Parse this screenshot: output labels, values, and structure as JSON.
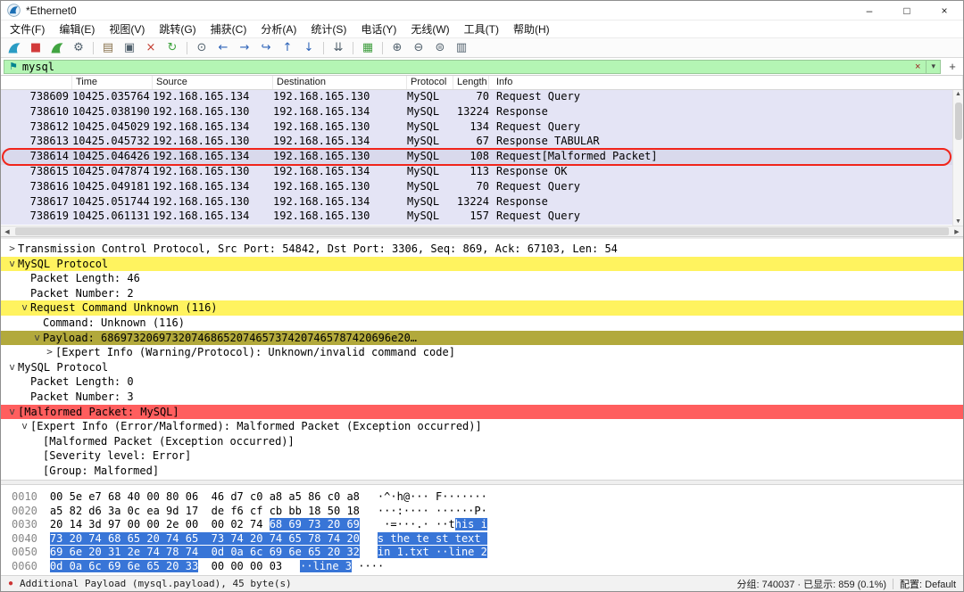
{
  "window": {
    "title": "*Ethernet0",
    "controls": [
      {
        "name": "minimize-button",
        "glyph": "–"
      },
      {
        "name": "maximize-button",
        "glyph": "□"
      },
      {
        "name": "close-button",
        "glyph": "×"
      }
    ]
  },
  "menu_bar": {
    "items": [
      "文件(F)",
      "编辑(E)",
      "视图(V)",
      "跳转(G)",
      "捕获(C)",
      "分析(A)",
      "统计(S)",
      "电话(Y)",
      "无线(W)",
      "工具(T)",
      "帮助(H)"
    ]
  },
  "toolbar": {
    "items": [
      {
        "name": "start-capture-icon",
        "kind": "fin",
        "color": "#2a9cc4"
      },
      {
        "name": "stop-capture-icon",
        "kind": "glyph",
        "glyph": "■",
        "color": "#d23b3b"
      },
      {
        "name": "restart-capture-icon",
        "kind": "fin",
        "color": "#41a441"
      },
      {
        "name": "capture-options-icon",
        "kind": "glyph",
        "glyph": "⚙",
        "color": "#50606c"
      },
      {
        "name": "toolbar-separator",
        "kind": "sep"
      },
      {
        "name": "open-file-icon",
        "kind": "glyph",
        "glyph": "▤",
        "color": "#8a7450"
      },
      {
        "name": "save-file-icon",
        "kind": "glyph",
        "glyph": "▣",
        "color": "#50606c"
      },
      {
        "name": "close-file-icon",
        "kind": "glyph",
        "glyph": "×",
        "color": "#c23b2e"
      },
      {
        "name": "reload-icon",
        "kind": "glyph",
        "glyph": "↻",
        "color": "#41a441"
      },
      {
        "name": "toolbar-separator",
        "kind": "sep"
      },
      {
        "name": "find-packet-icon",
        "kind": "glyph",
        "glyph": "⊙",
        "color": "#50606c"
      },
      {
        "name": "back-icon",
        "kind": "glyph",
        "glyph": "←",
        "color": "#2d63b8"
      },
      {
        "name": "forward-icon",
        "kind": "glyph",
        "glyph": "→",
        "color": "#2d63b8"
      },
      {
        "name": "goto-packet-icon",
        "kind": "glyph",
        "glyph": "↪",
        "color": "#2d63b8"
      },
      {
        "name": "first-packet-icon",
        "kind": "glyph",
        "glyph": "↑",
        "color": "#2d63b8"
      },
      {
        "name": "last-packet-icon",
        "kind": "glyph",
        "glyph": "↓",
        "color": "#2d63b8"
      },
      {
        "name": "toolbar-separator",
        "kind": "sep"
      },
      {
        "name": "autoscroll-icon",
        "kind": "glyph",
        "glyph": "⇊",
        "color": "#50606c"
      },
      {
        "name": "toolbar-separator",
        "kind": "sep"
      },
      {
        "name": "colorize-icon",
        "kind": "glyph",
        "glyph": "▦",
        "color": "#3f9e3f"
      },
      {
        "name": "toolbar-separator",
        "kind": "sep"
      },
      {
        "name": "zoom-in-icon",
        "kind": "glyph",
        "glyph": "⊕",
        "color": "#50606c"
      },
      {
        "name": "zoom-out-icon",
        "kind": "glyph",
        "glyph": "⊖",
        "color": "#50606c"
      },
      {
        "name": "zoom-100-icon",
        "kind": "glyph",
        "glyph": "⊜",
        "color": "#50606c"
      },
      {
        "name": "resize-columns-icon",
        "kind": "glyph",
        "glyph": "▥",
        "color": "#50606c"
      }
    ]
  },
  "filter": {
    "value": "mysql",
    "bookmark_glyph": "⚑",
    "clear_glyph": "×",
    "dropdown_glyph": "▾",
    "add_glyph": "+"
  },
  "packet_list": {
    "columns": [
      "",
      "Time",
      "Source",
      "Destination",
      "Protocol",
      "Length",
      "Info"
    ],
    "rows": [
      {
        "no": "738609",
        "time": "10425.035764",
        "source": "192.168.165.134",
        "destination": "192.168.165.130",
        "protocol": "MySQL",
        "length": "70",
        "info": "Request Query",
        "selected": false
      },
      {
        "no": "738610",
        "time": "10425.038190",
        "source": "192.168.165.130",
        "destination": "192.168.165.134",
        "protocol": "MySQL",
        "length": "13224",
        "info": "Response",
        "selected": false
      },
      {
        "no": "738612",
        "time": "10425.045029",
        "source": "192.168.165.134",
        "destination": "192.168.165.130",
        "protocol": "MySQL",
        "length": "134",
        "info": "Request Query",
        "selected": false
      },
      {
        "no": "738613",
        "time": "10425.045732",
        "source": "192.168.165.130",
        "destination": "192.168.165.134",
        "protocol": "MySQL",
        "length": "67",
        "info": "Response TABULAR",
        "selected": false
      },
      {
        "no": "738614",
        "time": "10425.046426",
        "source": "192.168.165.134",
        "destination": "192.168.165.130",
        "protocol": "MySQL",
        "length": "108",
        "info": "Request[Malformed Packet]",
        "selected": true
      },
      {
        "no": "738615",
        "time": "10425.047874",
        "source": "192.168.165.130",
        "destination": "192.168.165.134",
        "protocol": "MySQL",
        "length": "113",
        "info": "Response OK",
        "selected": false
      },
      {
        "no": "738616",
        "time": "10425.049181",
        "source": "192.168.165.134",
        "destination": "192.168.165.130",
        "protocol": "MySQL",
        "length": "70",
        "info": "Request Query",
        "selected": false
      },
      {
        "no": "738617",
        "time": "10425.051744",
        "source": "192.168.165.130",
        "destination": "192.168.165.134",
        "protocol": "MySQL",
        "length": "13224",
        "info": "Response",
        "selected": false
      },
      {
        "no": "738619",
        "time": "10425.061131",
        "source": "192.168.165.134",
        "destination": "192.168.165.130",
        "protocol": "MySQL",
        "length": "157",
        "info": "Request Query",
        "selected": false
      }
    ]
  },
  "detail_tree": {
    "lines": [
      {
        "indent": 0,
        "arrow": "right",
        "text": "Transmission Control Protocol, Src Port: 54842, Dst Port: 3306, Seq: 869, Ack: 67103, Len: 54",
        "bg": "none"
      },
      {
        "indent": 0,
        "arrow": "down",
        "text": "MySQL Protocol",
        "bg": "yellow"
      },
      {
        "indent": 1,
        "arrow": "none",
        "text": "Packet Length: 46",
        "bg": "none"
      },
      {
        "indent": 1,
        "arrow": "none",
        "text": "Packet Number: 2",
        "bg": "none"
      },
      {
        "indent": 1,
        "arrow": "down",
        "text": "Request Command Unknown (116)",
        "bg": "yellow"
      },
      {
        "indent": 2,
        "arrow": "none",
        "text": "Command: Unknown (116)",
        "bg": "none"
      },
      {
        "indent": 2,
        "arrow": "down",
        "text": "Payload: 686973206973207468652074657374207465787420696e20…",
        "bg": "olive"
      },
      {
        "indent": 3,
        "arrow": "right",
        "text": "[Expert Info (Warning/Protocol): Unknown/invalid command code]",
        "bg": "none"
      },
      {
        "indent": 0,
        "arrow": "down",
        "text": "MySQL Protocol",
        "bg": "none"
      },
      {
        "indent": 1,
        "arrow": "none",
        "text": "Packet Length: 0",
        "bg": "none"
      },
      {
        "indent": 1,
        "arrow": "none",
        "text": "Packet Number: 3",
        "bg": "none"
      },
      {
        "indent": 0,
        "arrow": "down",
        "text": "[Malformed Packet: MySQL]",
        "bg": "red"
      },
      {
        "indent": 1,
        "arrow": "down",
        "text": "[Expert Info (Error/Malformed): Malformed Packet (Exception occurred)]",
        "bg": "none"
      },
      {
        "indent": 2,
        "arrow": "none",
        "text": "[Malformed Packet (Exception occurred)]",
        "bg": "none"
      },
      {
        "indent": 2,
        "arrow": "none",
        "text": "[Severity level: Error]",
        "bg": "none"
      },
      {
        "indent": 2,
        "arrow": "none",
        "text": "[Group: Malformed]",
        "bg": "none"
      }
    ]
  },
  "hex_view": {
    "rows": [
      {
        "offset": "0010",
        "bytes": [
          "00",
          "5e",
          "e7",
          "68",
          "40",
          "00",
          "80",
          "06",
          "46",
          "d7",
          "c0",
          "a8",
          "a5",
          "86",
          "c0",
          "a8"
        ],
        "ascii": "·^·h@···F·······",
        "hl_start": -1,
        "hl_end": -1
      },
      {
        "offset": "0020",
        "bytes": [
          "a5",
          "82",
          "d6",
          "3a",
          "0c",
          "ea",
          "9d",
          "17",
          "de",
          "f6",
          "cf",
          "cb",
          "bb",
          "18",
          "50",
          "18"
        ],
        "ascii": "···:··········P·",
        "hl_start": -1,
        "hl_end": -1
      },
      {
        "offset": "0030",
        "bytes": [
          "20",
          "14",
          "3d",
          "97",
          "00",
          "00",
          "2e",
          "00",
          "00",
          "02",
          "74",
          "68",
          "69",
          "73",
          "20",
          "69"
        ],
        "ascii": " ·=···.···this i",
        "hl_start": 11,
        "hl_end": 15
      },
      {
        "offset": "0040",
        "bytes": [
          "73",
          "20",
          "74",
          "68",
          "65",
          "20",
          "74",
          "65",
          "73",
          "74",
          "20",
          "74",
          "65",
          "78",
          "74",
          "20"
        ],
        "ascii": "s the test text ",
        "hl_start": 0,
        "hl_end": 15
      },
      {
        "offset": "0050",
        "bytes": [
          "69",
          "6e",
          "20",
          "31",
          "2e",
          "74",
          "78",
          "74",
          "0d",
          "0a",
          "6c",
          "69",
          "6e",
          "65",
          "20",
          "32"
        ],
        "ascii": "in 1.txt··line 2",
        "hl_start": 0,
        "hl_end": 15
      },
      {
        "offset": "0060",
        "bytes": [
          "0d",
          "0a",
          "6c",
          "69",
          "6e",
          "65",
          "20",
          "33",
          "00",
          "00",
          "00",
          "03"
        ],
        "ascii": "··line 3····",
        "hl_start": 0,
        "hl_end": 7
      }
    ]
  },
  "status_bar": {
    "expert_glyph": "●",
    "left_text": "Additional Payload (mysql.payload), 45 byte(s)",
    "counts_text": "分组: 740037 · 已显示: 859 (0.1%)",
    "profile_text": "配置: Default"
  },
  "scrollbars": {
    "up": "▲",
    "down": "▼",
    "left": "◀",
    "right": "▶"
  },
  "colors": {
    "filter_valid_bg": "#b4f5b4",
    "row_lavender": "#e4e4f5",
    "row_selected": "#d9d9ec",
    "warn_yellow": "#fff35f",
    "payload_olive": "#b2a93c",
    "error_red": "#ff5e5e",
    "hex_selection": "#3875d7",
    "annotation_red": "#f1251b",
    "brand_blue": "#1b6fb5"
  }
}
